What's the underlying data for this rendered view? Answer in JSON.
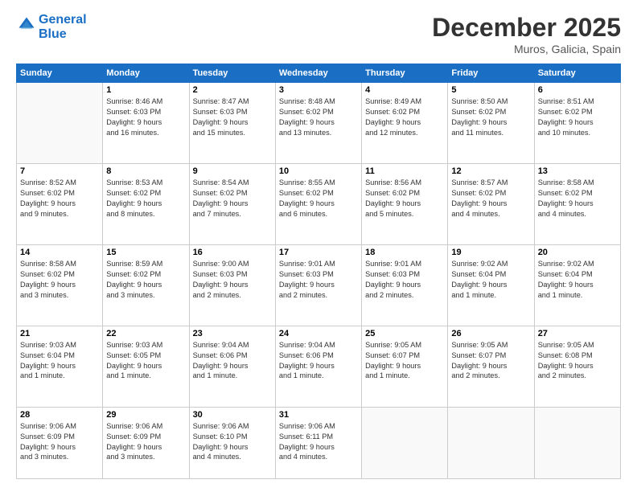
{
  "logo": {
    "line1": "General",
    "line2": "Blue"
  },
  "title": "December 2025",
  "location": "Muros, Galicia, Spain",
  "days_header": [
    "Sunday",
    "Monday",
    "Tuesday",
    "Wednesday",
    "Thursday",
    "Friday",
    "Saturday"
  ],
  "weeks": [
    [
      {
        "day": "",
        "info": ""
      },
      {
        "day": "1",
        "info": "Sunrise: 8:46 AM\nSunset: 6:03 PM\nDaylight: 9 hours\nand 16 minutes."
      },
      {
        "day": "2",
        "info": "Sunrise: 8:47 AM\nSunset: 6:03 PM\nDaylight: 9 hours\nand 15 minutes."
      },
      {
        "day": "3",
        "info": "Sunrise: 8:48 AM\nSunset: 6:02 PM\nDaylight: 9 hours\nand 13 minutes."
      },
      {
        "day": "4",
        "info": "Sunrise: 8:49 AM\nSunset: 6:02 PM\nDaylight: 9 hours\nand 12 minutes."
      },
      {
        "day": "5",
        "info": "Sunrise: 8:50 AM\nSunset: 6:02 PM\nDaylight: 9 hours\nand 11 minutes."
      },
      {
        "day": "6",
        "info": "Sunrise: 8:51 AM\nSunset: 6:02 PM\nDaylight: 9 hours\nand 10 minutes."
      }
    ],
    [
      {
        "day": "7",
        "info": "Sunrise: 8:52 AM\nSunset: 6:02 PM\nDaylight: 9 hours\nand 9 minutes."
      },
      {
        "day": "8",
        "info": "Sunrise: 8:53 AM\nSunset: 6:02 PM\nDaylight: 9 hours\nand 8 minutes."
      },
      {
        "day": "9",
        "info": "Sunrise: 8:54 AM\nSunset: 6:02 PM\nDaylight: 9 hours\nand 7 minutes."
      },
      {
        "day": "10",
        "info": "Sunrise: 8:55 AM\nSunset: 6:02 PM\nDaylight: 9 hours\nand 6 minutes."
      },
      {
        "day": "11",
        "info": "Sunrise: 8:56 AM\nSunset: 6:02 PM\nDaylight: 9 hours\nand 5 minutes."
      },
      {
        "day": "12",
        "info": "Sunrise: 8:57 AM\nSunset: 6:02 PM\nDaylight: 9 hours\nand 4 minutes."
      },
      {
        "day": "13",
        "info": "Sunrise: 8:58 AM\nSunset: 6:02 PM\nDaylight: 9 hours\nand 4 minutes."
      }
    ],
    [
      {
        "day": "14",
        "info": "Sunrise: 8:58 AM\nSunset: 6:02 PM\nDaylight: 9 hours\nand 3 minutes."
      },
      {
        "day": "15",
        "info": "Sunrise: 8:59 AM\nSunset: 6:02 PM\nDaylight: 9 hours\nand 3 minutes."
      },
      {
        "day": "16",
        "info": "Sunrise: 9:00 AM\nSunset: 6:03 PM\nDaylight: 9 hours\nand 2 minutes."
      },
      {
        "day": "17",
        "info": "Sunrise: 9:01 AM\nSunset: 6:03 PM\nDaylight: 9 hours\nand 2 minutes."
      },
      {
        "day": "18",
        "info": "Sunrise: 9:01 AM\nSunset: 6:03 PM\nDaylight: 9 hours\nand 2 minutes."
      },
      {
        "day": "19",
        "info": "Sunrise: 9:02 AM\nSunset: 6:04 PM\nDaylight: 9 hours\nand 1 minute."
      },
      {
        "day": "20",
        "info": "Sunrise: 9:02 AM\nSunset: 6:04 PM\nDaylight: 9 hours\nand 1 minute."
      }
    ],
    [
      {
        "day": "21",
        "info": "Sunrise: 9:03 AM\nSunset: 6:04 PM\nDaylight: 9 hours\nand 1 minute."
      },
      {
        "day": "22",
        "info": "Sunrise: 9:03 AM\nSunset: 6:05 PM\nDaylight: 9 hours\nand 1 minute."
      },
      {
        "day": "23",
        "info": "Sunrise: 9:04 AM\nSunset: 6:06 PM\nDaylight: 9 hours\nand 1 minute."
      },
      {
        "day": "24",
        "info": "Sunrise: 9:04 AM\nSunset: 6:06 PM\nDaylight: 9 hours\nand 1 minute."
      },
      {
        "day": "25",
        "info": "Sunrise: 9:05 AM\nSunset: 6:07 PM\nDaylight: 9 hours\nand 1 minute."
      },
      {
        "day": "26",
        "info": "Sunrise: 9:05 AM\nSunset: 6:07 PM\nDaylight: 9 hours\nand 2 minutes."
      },
      {
        "day": "27",
        "info": "Sunrise: 9:05 AM\nSunset: 6:08 PM\nDaylight: 9 hours\nand 2 minutes."
      }
    ],
    [
      {
        "day": "28",
        "info": "Sunrise: 9:06 AM\nSunset: 6:09 PM\nDaylight: 9 hours\nand 3 minutes."
      },
      {
        "day": "29",
        "info": "Sunrise: 9:06 AM\nSunset: 6:09 PM\nDaylight: 9 hours\nand 3 minutes."
      },
      {
        "day": "30",
        "info": "Sunrise: 9:06 AM\nSunset: 6:10 PM\nDaylight: 9 hours\nand 4 minutes."
      },
      {
        "day": "31",
        "info": "Sunrise: 9:06 AM\nSunset: 6:11 PM\nDaylight: 9 hours\nand 4 minutes."
      },
      {
        "day": "",
        "info": ""
      },
      {
        "day": "",
        "info": ""
      },
      {
        "day": "",
        "info": ""
      }
    ]
  ]
}
